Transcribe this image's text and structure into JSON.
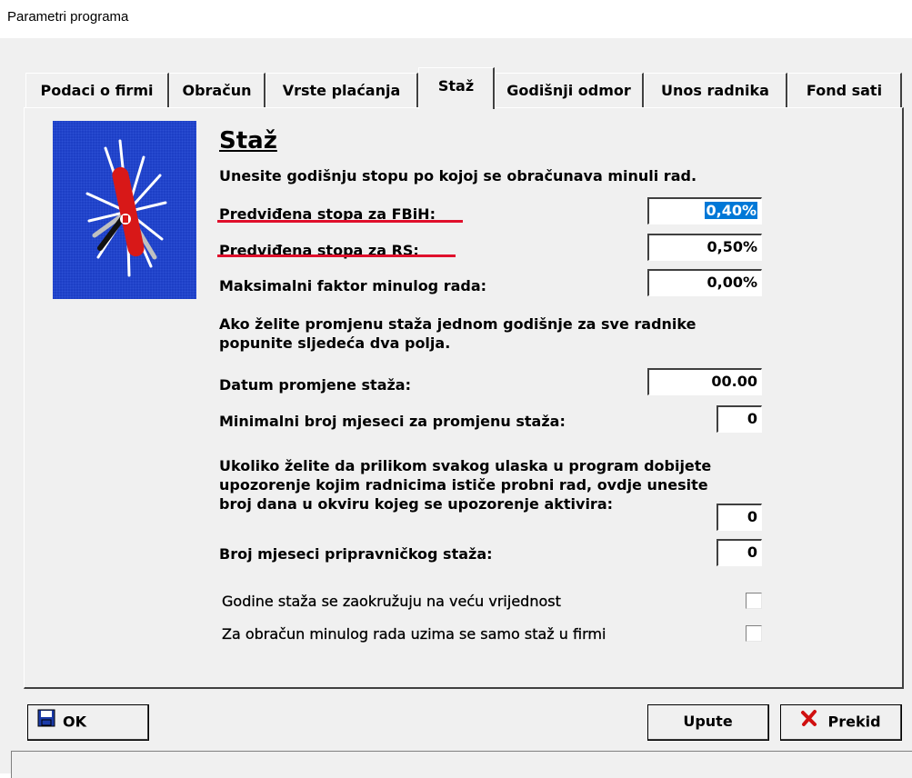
{
  "window": {
    "title": "Parametri programa"
  },
  "tabs": [
    {
      "label": "Podaci o firmi"
    },
    {
      "label": "Obračun"
    },
    {
      "label": "Vrste plaćanja"
    },
    {
      "label": "Staž"
    },
    {
      "label": "Godišnji odmor"
    },
    {
      "label": "Unos radnika"
    },
    {
      "label": "Fond sati"
    }
  ],
  "panel": {
    "heading": "Staž",
    "intro": "Unesite godišnju stopu po kojoj se obračunava minuli rad.",
    "fbih_label": "Predviđena stopa za FBiH:",
    "fbih_value": "0,40%",
    "rs_label": "Predviđena stopa za RS:",
    "rs_value": "0,50%",
    "max_label": "Maksimalni faktor minulog rada:",
    "max_value": "0,00%",
    "change_intro_1": "Ako želite promjenu staža jednom godišnje za sve radnike",
    "change_intro_2": "popunite sljedeća dva polja.",
    "date_label": "Datum promjene staža:",
    "date_value": "00.00",
    "min_months_label": "Minimalni broj mjeseci za promjenu staža:",
    "min_months_value": "0",
    "probation_1": "Ukoliko želite da prilikom svakog ulaska u program dobijete",
    "probation_2": "upozorenje kojim radnicima ističe probni rad, ovdje unesite",
    "probation_3": "broj dana u okviru kojeg se upozorenje aktivira:",
    "probation_value": "0",
    "intern_label": "Broj mjeseci pripravničkog staža:",
    "intern_value": "0",
    "round_label": "Godine staža se zaokružuju na veću vrijednost",
    "round_checked": false,
    "firm_label": "Za obračun minulog rada uzima se samo staž u firmi",
    "firm_checked": false
  },
  "buttons": {
    "ok": "OK",
    "help": "Upute",
    "cancel": "Prekid"
  },
  "colors": {
    "selection": "#0078d7",
    "annotation_underline": "#e0102c",
    "logo_bg": "#1d3fc6"
  }
}
